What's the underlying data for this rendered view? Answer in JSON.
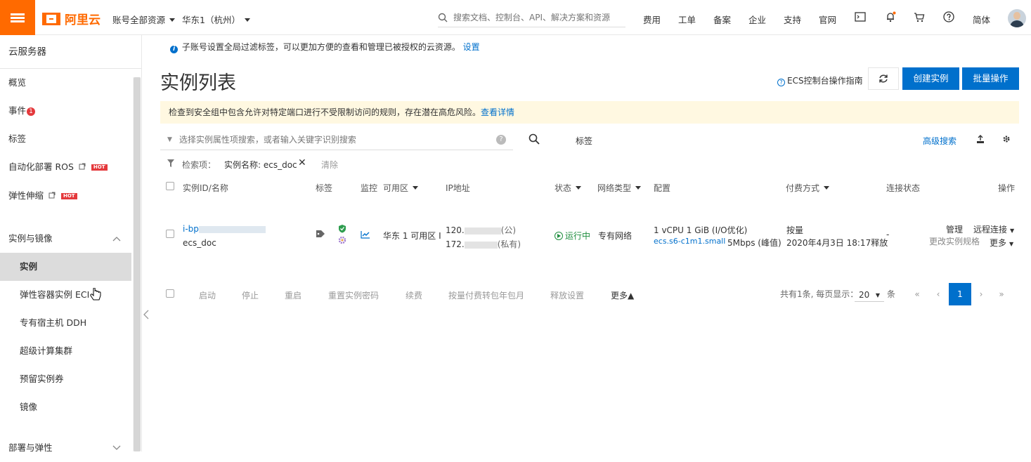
{
  "topbar": {
    "logo_text": "阿里云",
    "account_scope": "账号全部资源",
    "region": "华东1（杭州）",
    "search_placeholder": "搜索文档、控制台、API、解决方案和资源",
    "links": [
      "费用",
      "工单",
      "备案",
      "企业",
      "支持",
      "官网"
    ],
    "language": "简体"
  },
  "sidebar": {
    "title": "云服务器",
    "items": [
      {
        "label": "概览"
      },
      {
        "label": "事件",
        "badge": "1"
      },
      {
        "label": "标签"
      },
      {
        "label": "自动化部署 ROS",
        "hot": "HOT"
      },
      {
        "label": "弹性伸缩",
        "hot": "HOT"
      }
    ],
    "group1": "实例与镜像",
    "sub_items": [
      "实例",
      "弹性容器实例 ECI",
      "专有宿主机 DDH",
      "超级计算集群",
      "预留实例券",
      "镜像"
    ],
    "group2": "部署与弹性"
  },
  "notice": {
    "text": "子账号设置全局过滤标签，可以更加方便的查看和管理已被授权的云资源。",
    "link": "设置"
  },
  "page": {
    "title": "实例列表",
    "guide": "ECS控制台操作指南",
    "create_btn": "创建实例",
    "batch_btn": "批量操作"
  },
  "warning": {
    "text": "检查到安全组中包含允许对特定端口进行不受限制访问的规则，存在潜在高危风险。",
    "link": "查看详情"
  },
  "filter": {
    "placeholder": "选择实例属性项搜索，或者输入关键字识别搜索",
    "tag_label": "标签",
    "advanced": "高级搜索",
    "criteria_label": "检索项：",
    "criteria_value": "实例名称: ecs_doc",
    "clear": "清除"
  },
  "table": {
    "headers": {
      "id": "实例ID/名称",
      "tag": "标签",
      "monitor": "监控",
      "zone": "可用区",
      "ip": "IP地址",
      "status": "状态",
      "network": "网络类型",
      "config": "配置",
      "billing": "付费方式",
      "conn": "连接状态",
      "ops": "操作"
    },
    "row": {
      "id_prefix": "i-bp",
      "name": "ecs_doc",
      "zone": "华东 1 可用区 I",
      "ip_public_prefix": "120.",
      "ip_public_suffix": "(公)",
      "ip_private_prefix": "172.",
      "ip_private_suffix": "(私有)",
      "status": "运行中",
      "network": "专有网络",
      "config_line1": "1 vCPU 1 GiB (I/O优化)",
      "config_type": "ecs.s6-c1m1.small",
      "config_bw": "5Mbps (峰值)",
      "billing_line1": "按量",
      "billing_line2": "2020年4月3日 18:17释放",
      "conn": "-",
      "op_manage": "管理",
      "op_remote": "远程连接",
      "op_change": "更改实例规格",
      "op_more": "更多"
    }
  },
  "bottom_actions": [
    "启动",
    "停止",
    "重启",
    "重置实例密码",
    "续费",
    "按量付费转包年包月",
    "释放设置",
    "更多▲"
  ],
  "pagination": {
    "total_text": "共有1条, 每页显示：",
    "page_size": "20",
    "unit": "条",
    "current": "1",
    "first": "«",
    "prev": "‹",
    "next": "›",
    "last": "»"
  },
  "colors": {
    "brand": "#ff6a00",
    "primary": "#0070cc",
    "running": "#1e8e3e"
  }
}
